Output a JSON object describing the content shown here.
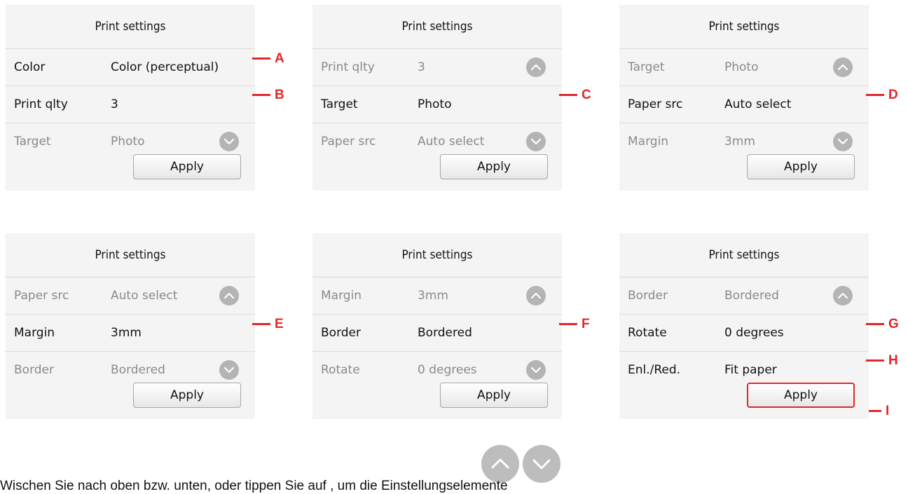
{
  "panels": [
    {
      "title": "Print settings",
      "rows": [
        {
          "label": "Color",
          "value": "Color (perceptual)"
        },
        {
          "label": "Print qlty",
          "value": "3"
        },
        {
          "label": "Target",
          "value": "Photo"
        }
      ],
      "apply": "Apply"
    },
    {
      "title": "Print settings",
      "rows": [
        {
          "label": "Print qlty",
          "value": "3"
        },
        {
          "label": "Target",
          "value": "Photo"
        },
        {
          "label": "Paper src",
          "value": "Auto select"
        }
      ],
      "apply": "Apply"
    },
    {
      "title": "Print settings",
      "rows": [
        {
          "label": "Target",
          "value": "Photo"
        },
        {
          "label": "Paper src",
          "value": "Auto select"
        },
        {
          "label": "Margin",
          "value": "3mm"
        }
      ],
      "apply": "Apply"
    },
    {
      "title": "Print settings",
      "rows": [
        {
          "label": "Paper src",
          "value": "Auto select"
        },
        {
          "label": "Margin",
          "value": "3mm"
        },
        {
          "label": "Border",
          "value": "Bordered"
        }
      ],
      "apply": "Apply"
    },
    {
      "title": "Print settings",
      "rows": [
        {
          "label": "Margin",
          "value": "3mm"
        },
        {
          "label": "Border",
          "value": "Bordered"
        },
        {
          "label": "Rotate",
          "value": "0 degrees"
        }
      ],
      "apply": "Apply"
    },
    {
      "title": "Print settings",
      "rows": [
        {
          "label": "Border",
          "value": "Bordered"
        },
        {
          "label": "Rotate",
          "value": "0 degrees"
        },
        {
          "label": "Enl./Red.",
          "value": "Fit paper"
        }
      ],
      "apply": "Apply"
    }
  ],
  "callouts": {
    "a": "A",
    "b": "B",
    "c": "C",
    "d": "D",
    "e": "E",
    "f": "F",
    "g": "G",
    "h": "H",
    "i": "I"
  },
  "caption": "Wischen Sie nach oben bzw. unten, oder tippen Sie auf          , um die Einstellungselemente",
  "icons": {
    "scroll_up": "chevron-up-icon",
    "scroll_down": "chevron-down-icon"
  },
  "colors": {
    "callout": "#e0282a",
    "panel_bg": "#f4f4f4",
    "scroll_button": "#b4b4b4"
  }
}
